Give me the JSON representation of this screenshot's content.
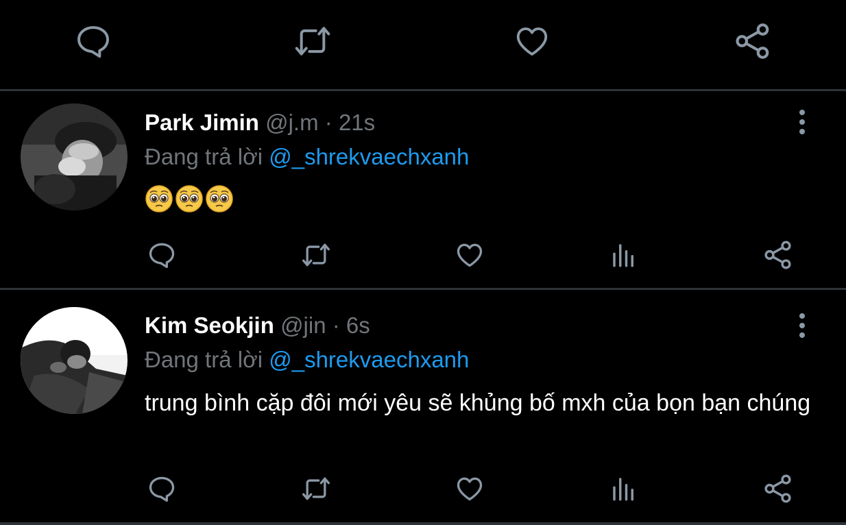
{
  "top_actions": {
    "icons": [
      "reply-icon",
      "retweet-icon",
      "like-icon",
      "share-icon"
    ]
  },
  "tweets": [
    {
      "name": "Park Jimin",
      "handle": "@j.m",
      "separator": "·",
      "time": "21s",
      "reply_prefix": "Đang trả lời",
      "reply_to": "@_shrekvaechxanh",
      "content": "🥺🥺🥺",
      "avatar": "avatar-park-jimin"
    },
    {
      "name": "Kim Seokjin",
      "handle": "@jin",
      "separator": "·",
      "time": "6s",
      "reply_prefix": "Đang trả lời",
      "reply_to": "@_shrekvaechxanh",
      "content": "trung bình cặp đôi mới yêu sẽ khủng bố mxh của bọn bạn chúng",
      "avatar": "avatar-kim-seokjin"
    }
  ],
  "colors": {
    "background": "#000000",
    "muted": "#71767b",
    "link": "#1d9bf0",
    "divider": "#2f3336",
    "icon": "#8b98a5"
  }
}
